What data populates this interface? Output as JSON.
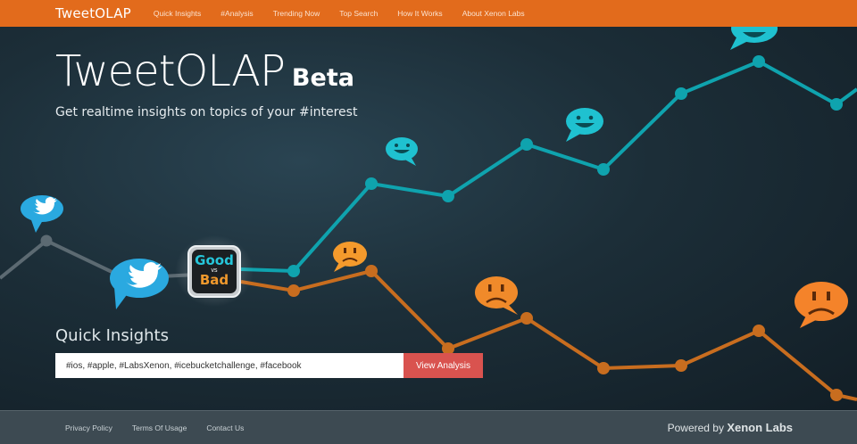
{
  "nav": {
    "brand": "TweetOLAP",
    "items": [
      "Quick Insights",
      "#Analysis",
      "Trending Now",
      "Top Search",
      "How It Works",
      "About Xenon Labs"
    ]
  },
  "hero": {
    "title": "TweetOLAP",
    "beta": "Beta",
    "subtitle": "Get realtime insights on topics of your #interest",
    "badge_top": "Good",
    "badge_vs": "vs",
    "badge_bottom": "Bad"
  },
  "quick_insights": {
    "label": "Quick Insights",
    "input_value": "#ios, #apple, #LabsXenon, #icebucketchallenge, #facebook",
    "button_label": "View Analysis"
  },
  "footer": {
    "links": [
      "Privacy Policy",
      "Terms Of Usage",
      "Contact Us"
    ],
    "powered_prefix": "Powered by",
    "powered_brand": "Xenon Labs"
  },
  "colors": {
    "nav": "#e26b1c",
    "teal": "#0fa3ae",
    "orange": "#c86d1f",
    "button": "#d9534f",
    "footer": "#3d4a52"
  }
}
